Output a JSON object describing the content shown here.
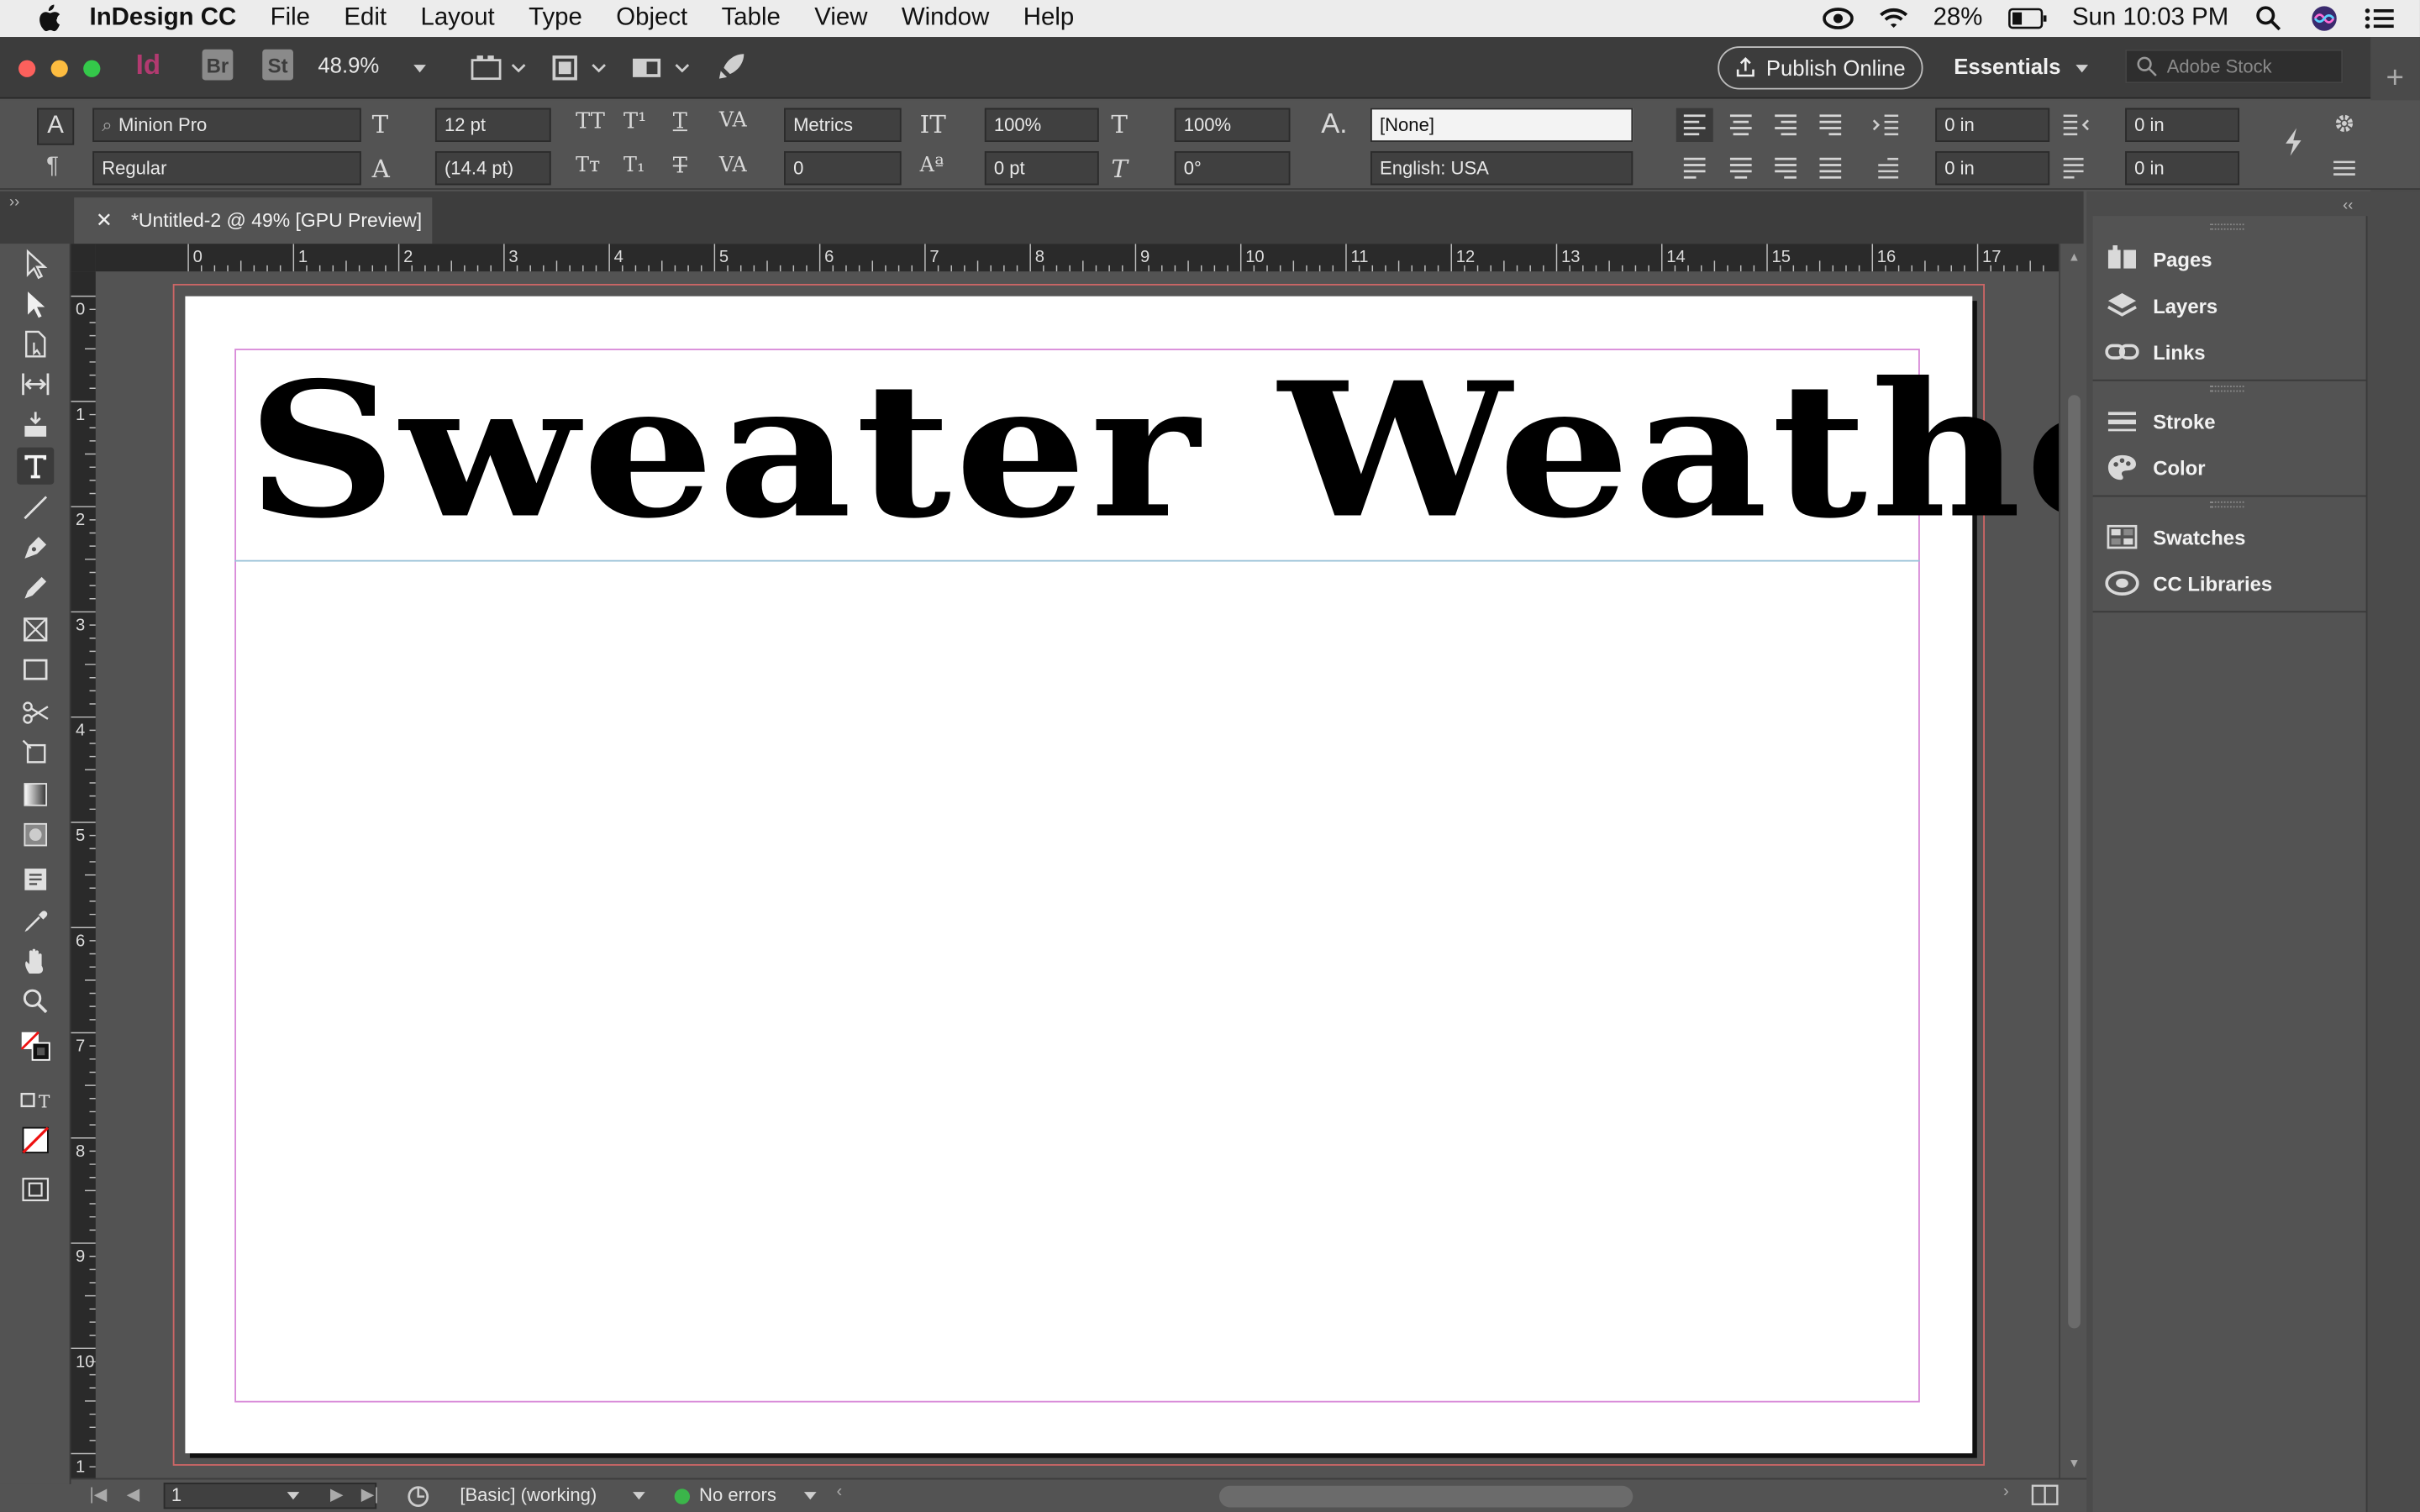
{
  "menubar": {
    "app_name": "InDesign CC",
    "items": [
      "File",
      "Edit",
      "Layout",
      "Type",
      "Object",
      "Table",
      "View",
      "Window",
      "Help"
    ],
    "battery": "28%",
    "clock": "Sun 10:03 PM"
  },
  "appbar": {
    "zoom": "48.9%",
    "badge_id": "Id",
    "badge_br": "Br",
    "badge_st": "St",
    "publish_label": "Publish Online",
    "workspace": "Essentials",
    "stock_placeholder": "Adobe Stock"
  },
  "control": {
    "font_family": "Minion Pro",
    "font_style": "Regular",
    "font_size": "12 pt",
    "leading": "(14.4 pt)",
    "kerning": "Metrics",
    "tracking": "0",
    "vscale": "100%",
    "hscale": "100%",
    "baseline": "0 pt",
    "skew": "0°",
    "char_style": "[None]",
    "language": "English: USA",
    "left_indent": "0 in",
    "right_indent": "0 in",
    "first_indent": "0 in",
    "last_indent": "0 in"
  },
  "document": {
    "tab_title": "*Untitled-2 @ 49% [GPU Preview]",
    "headline": "Sweater Weather"
  },
  "rulers": {
    "horizontal": [
      "0",
      "1",
      "2",
      "3",
      "4",
      "5",
      "6",
      "7",
      "8",
      "9",
      "10",
      "11",
      "12",
      "13",
      "14",
      "15",
      "16",
      "17"
    ],
    "vertical": [
      "0",
      "1",
      "2",
      "3",
      "4",
      "5",
      "6",
      "7",
      "8",
      "9",
      "10",
      "1"
    ]
  },
  "status": {
    "page_number": "1",
    "preflight_profile": "[Basic] (working)",
    "errors": "No errors"
  },
  "panels": [
    {
      "label": "Pages",
      "icon": "pages-icon"
    },
    {
      "label": "Layers",
      "icon": "layers-icon"
    },
    {
      "label": "Links",
      "icon": "links-icon"
    },
    {
      "label": "Stroke",
      "icon": "stroke-icon"
    },
    {
      "label": "Color",
      "icon": "color-icon"
    },
    {
      "label": "Swatches",
      "icon": "swatches-icon"
    },
    {
      "label": "CC Libraries",
      "icon": "cc-libraries-icon"
    }
  ],
  "colors": {
    "ui_dark": "#535353",
    "menubar": "#ececec",
    "margin_guide": "#d88ad8",
    "bleed_guide": "#cc6666",
    "status_ok": "#3bb54a",
    "id_badge": "#b23a70"
  }
}
